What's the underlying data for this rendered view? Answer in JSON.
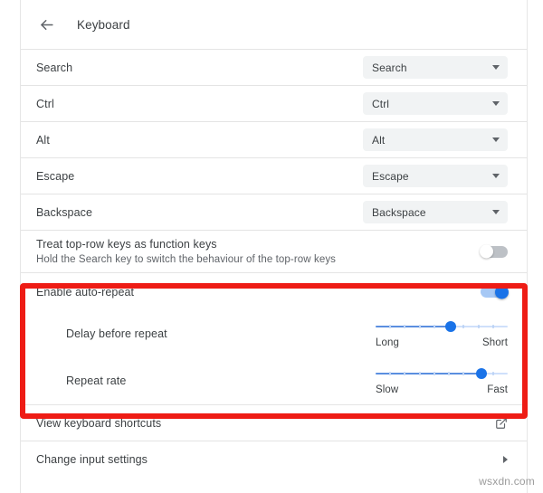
{
  "header": {
    "back_icon": "arrow-left-icon",
    "title": "Keyboard"
  },
  "key_remap_rows": [
    {
      "label": "Search",
      "value": "Search"
    },
    {
      "label": "Ctrl",
      "value": "Ctrl"
    },
    {
      "label": "Alt",
      "value": "Alt"
    },
    {
      "label": "Escape",
      "value": "Escape"
    },
    {
      "label": "Backspace",
      "value": "Backspace"
    }
  ],
  "top_row": {
    "label": "Treat top-row keys as function keys",
    "sublabel": "Hold the Search key to switch the behaviour of the top-row keys",
    "toggle_state": "off"
  },
  "auto_repeat": {
    "label": "Enable auto-repeat",
    "toggle_state": "on",
    "sliders": [
      {
        "label": "Delay before repeat",
        "min_label": "Long",
        "max_label": "Short",
        "value_percent": 57,
        "ticks": 9
      },
      {
        "label": "Repeat rate",
        "min_label": "Slow",
        "max_label": "Fast",
        "value_percent": 80,
        "ticks": 9
      }
    ]
  },
  "link_rows": [
    {
      "label": "View keyboard shortcuts",
      "icon": "external-link-icon"
    },
    {
      "label": "Change input settings",
      "icon": "chevron-right-icon"
    }
  ],
  "watermark": "wsxdn.com",
  "colors": {
    "accent": "#1a73e8",
    "toggle_on_track": "#a6c8f5",
    "toggle_off_track": "#bdc1c6",
    "dropdown_bg": "#f1f3f4",
    "highlight_box": "#ee1c15",
    "text_primary": "#3c4043",
    "text_secondary": "#5f6368",
    "divider": "#e4e4e4"
  }
}
